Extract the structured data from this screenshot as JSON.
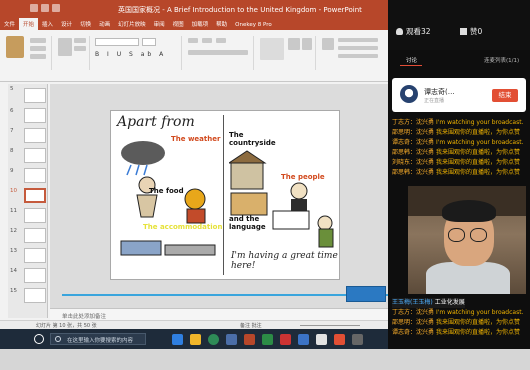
{
  "ppt": {
    "title": "英国国家概况 - A Brief Introduction to the United Kingdom - PowerPoint",
    "tabs": [
      "文件",
      "开始",
      "插入",
      "设计",
      "切换",
      "动画",
      "幻灯片放映",
      "审阅",
      "视图",
      "加载项",
      "帮助",
      "Onekey 8 Pro"
    ],
    "active_tab": "开始",
    "thumb_numbers": [
      "5",
      "6",
      "7",
      "8",
      "9",
      "10",
      "11",
      "12",
      "13",
      "14",
      "15"
    ],
    "selected_thumb": "10",
    "notes_placeholder": "单击此处添加备注",
    "status_left": "幻灯片 第 10 张，共 50 张",
    "status_right": "备注   批注",
    "slide": {
      "title": "Apart from",
      "left": [
        "The weather",
        "The food",
        "The accommodation"
      ],
      "right": [
        "The countryside",
        "The people",
        "and the language"
      ],
      "handwriting": "I'm having a great time here!"
    }
  },
  "taskbar": {
    "search_placeholder": "在这里输入你要搜索的内容"
  },
  "live": {
    "viewers_label": "观看",
    "viewers": "32",
    "likes_label": "赞",
    "likes": "0",
    "tab_chat": "讨论",
    "tab_other": "连麦列表(1/1)",
    "host_name": "谭志奇(…",
    "host_sub": "正在直播",
    "end_button": "结束",
    "messages": [
      {
        "user": "丁志方：沈兴勇",
        "text": "I'm watching your broadcast.",
        "sys": false
      },
      {
        "user": "邵思明：沈兴勇",
        "text": "我来围观你的直播啦，为你点赞",
        "sys": false
      },
      {
        "user": "谭志奇：沈兴勇",
        "text": "I'm watching your broadcast.",
        "sys": false
      },
      {
        "user": "邵思韩：沈兴勇",
        "text": "我来围观你的直播啦，为你点赞",
        "sys": false
      },
      {
        "user": "刘晓东：沈兴勇",
        "text": "我来围观你的直播啦，为你点赞",
        "sys": false
      },
      {
        "user": "邵思韩：沈兴勇",
        "text": "我来围观你的直播啦，为你点赞",
        "sys": false
      },
      {
        "user": "王玉梅(王玉梅)",
        "text": "工业化发展",
        "sys": true
      },
      {
        "user": "丁志方：沈兴勇",
        "text": "I'm watching your broadcast.",
        "sys": false
      },
      {
        "user": "邵思明：沈兴勇",
        "text": "我来围观你的直播啦，为你点赞",
        "sys": false
      },
      {
        "user": "谭志奇：沈兴勇",
        "text": "我来围观你的直播啦，为你点赞",
        "sys": false
      },
      {
        "user": "邵思韩：沈兴勇",
        "text": "我来围观你的直播啦，为你点赞",
        "sys": false
      }
    ]
  },
  "colors": {
    "ppt_accent": "#b7472a",
    "live_bg": "#0e0e0e",
    "end_button": "#e24f34",
    "chat_text": "#f0b400"
  }
}
